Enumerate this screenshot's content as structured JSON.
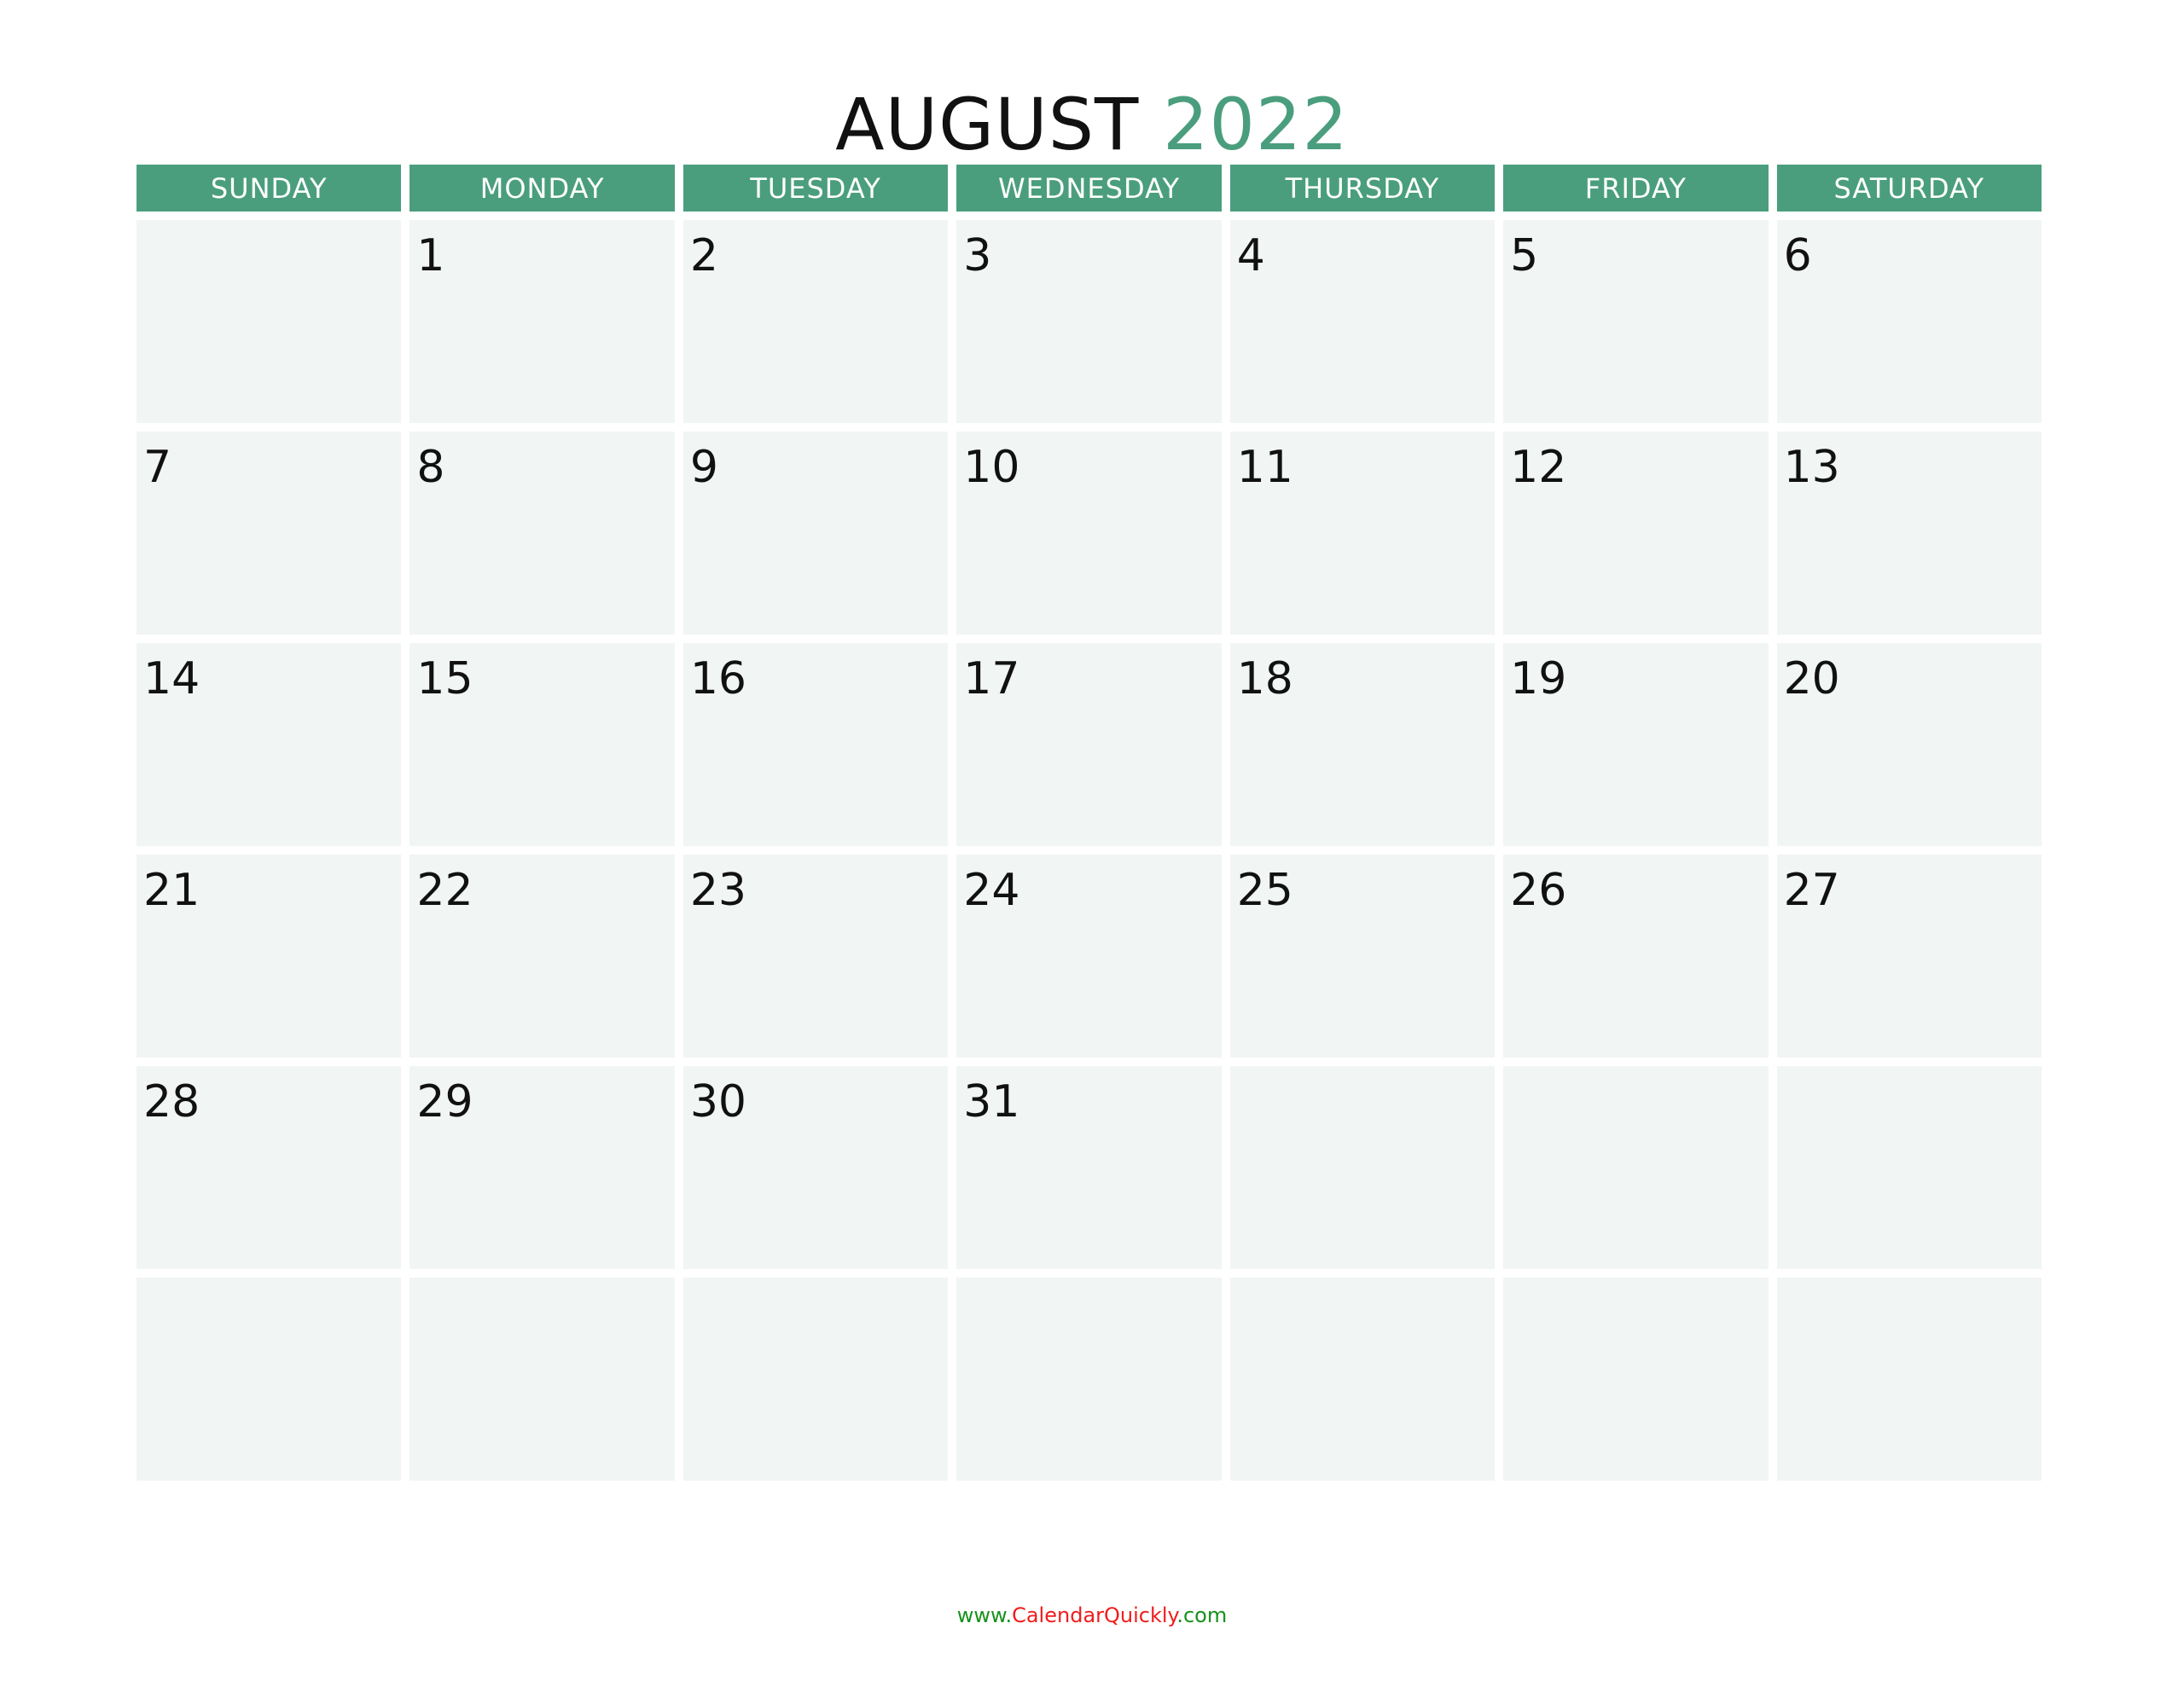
{
  "title": {
    "month": "AUGUST",
    "year": "2022"
  },
  "colors": {
    "accent": "#4a9e7e",
    "cell_bg": "#f1f5f4",
    "footer_green": "#17911b",
    "footer_red": "#f01c1c"
  },
  "weekdays": [
    "SUNDAY",
    "MONDAY",
    "TUESDAY",
    "WEDNESDAY",
    "THURSDAY",
    "FRIDAY",
    "SATURDAY"
  ],
  "weeks": [
    [
      "",
      "1",
      "2",
      "3",
      "4",
      "5",
      "6"
    ],
    [
      "7",
      "8",
      "9",
      "10",
      "11",
      "12",
      "13"
    ],
    [
      "14",
      "15",
      "16",
      "17",
      "18",
      "19",
      "20"
    ],
    [
      "21",
      "22",
      "23",
      "24",
      "25",
      "26",
      "27"
    ],
    [
      "28",
      "29",
      "30",
      "31",
      "",
      "",
      ""
    ],
    [
      "",
      "",
      "",
      "",
      "",
      "",
      ""
    ]
  ],
  "footer": {
    "prefix": "www.",
    "brand": "CalendarQuickly",
    "suffix": ".com"
  }
}
